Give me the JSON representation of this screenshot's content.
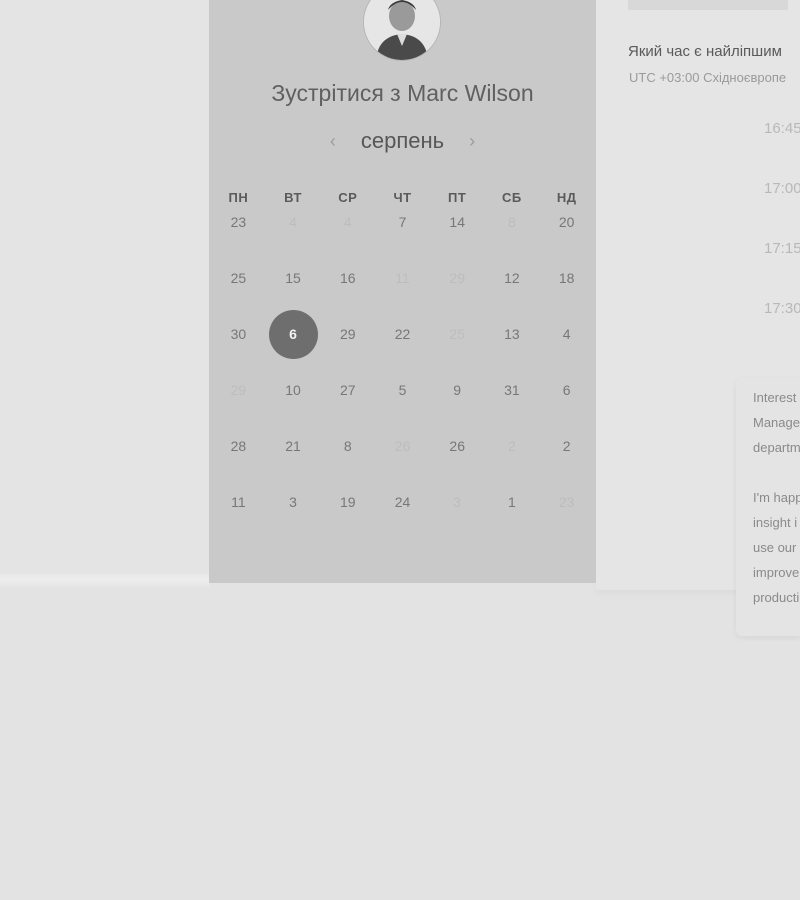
{
  "scheduler": {
    "title": "Зустрітися з Marc Wilson",
    "month": "серпень",
    "prev_icon": "chevron-left-icon",
    "next_icon": "chevron-right-icon",
    "weekdays": [
      "ПН",
      "ВТ",
      "СР",
      "ЧТ",
      "ПТ",
      "СБ",
      "НД"
    ],
    "selected_day": "6"
  },
  "calendar_rows": [
    [
      {
        "d": "23",
        "dim": false
      },
      {
        "d": "4",
        "dim": true
      },
      {
        "d": "4",
        "dim": true
      },
      {
        "d": "7",
        "dim": false
      },
      {
        "d": "14",
        "dim": false
      },
      {
        "d": "8",
        "dim": true
      },
      {
        "d": "20",
        "dim": false
      }
    ],
    [
      {
        "d": "25",
        "dim": false
      },
      {
        "d": "15",
        "dim": false
      },
      {
        "d": "16",
        "dim": false
      },
      {
        "d": "11",
        "dim": true
      },
      {
        "d": "29",
        "dim": true
      },
      {
        "d": "12",
        "dim": false
      },
      {
        "d": "18",
        "dim": false
      }
    ],
    [
      {
        "d": "30",
        "dim": false
      },
      {
        "d": "6",
        "dim": false,
        "sel": true
      },
      {
        "d": "29",
        "dim": false
      },
      {
        "d": "22",
        "dim": false
      },
      {
        "d": "25",
        "dim": true
      },
      {
        "d": "13",
        "dim": false
      },
      {
        "d": "4",
        "dim": false
      }
    ],
    [
      {
        "d": "29",
        "dim": true
      },
      {
        "d": "10",
        "dim": false
      },
      {
        "d": "27",
        "dim": false
      },
      {
        "d": "5",
        "dim": false
      },
      {
        "d": "9",
        "dim": false
      },
      {
        "d": "31",
        "dim": false
      },
      {
        "d": "6",
        "dim": false
      }
    ],
    [
      {
        "d": "28",
        "dim": false
      },
      {
        "d": "21",
        "dim": false
      },
      {
        "d": "8",
        "dim": false
      },
      {
        "d": "26",
        "dim": true
      },
      {
        "d": "26",
        "dim": false
      },
      {
        "d": "2",
        "dim": true
      },
      {
        "d": "2",
        "dim": false
      }
    ],
    [
      {
        "d": "11",
        "dim": false
      },
      {
        "d": "3",
        "dim": false
      },
      {
        "d": "19",
        "dim": false
      },
      {
        "d": "24",
        "dim": false
      },
      {
        "d": "3",
        "dim": true
      },
      {
        "d": "1",
        "dim": false
      },
      {
        "d": "23",
        "dim": true
      }
    ]
  ],
  "time_panel": {
    "question": "Який час є найліпшим",
    "timezone": "UTC +03:00 Східноєвропе",
    "slots": [
      "16:45",
      "17:00",
      "17:15",
      "17:30"
    ]
  },
  "bio": {
    "para1": [
      "Interest",
      "Manage",
      "departm"
    ],
    "para2": [
      "I'm happ",
      "insight i",
      "use our",
      "improve",
      "producti"
    ]
  }
}
